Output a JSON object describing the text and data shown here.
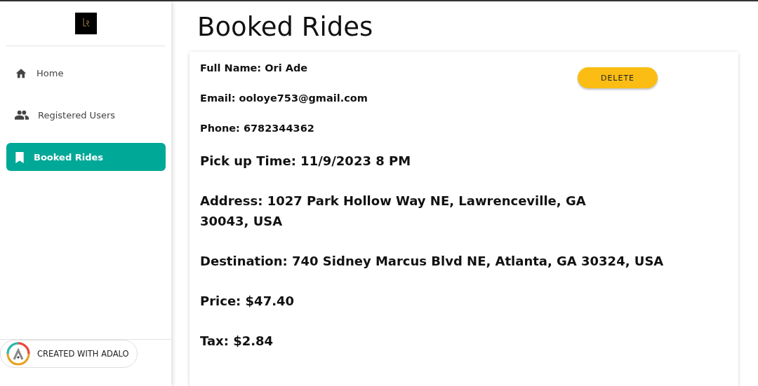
{
  "sidebar": {
    "items": [
      {
        "label": "Home",
        "selected": false
      },
      {
        "label": "Registered Users",
        "selected": false
      },
      {
        "label": "Booked Rides",
        "selected": true
      }
    ]
  },
  "page_title": "Booked Rides",
  "booking": {
    "small_lines": [
      "Full Name: Ori Ade",
      "Email: ooloye753@gmail.com",
      "Phone: 6782344362"
    ],
    "delete_button": "DELETE",
    "large_lines": [
      "Pick up Time: 11/9/2023 8 PM",
      "Address: 1027 Park Hollow Way NE, Lawrenceville, GA 30043, USA",
      "Destination: 740 Sidney Marcus Blvd NE, Atlanta, GA 30324, USA",
      "Price: $47.40",
      "Tax: $2.84"
    ]
  },
  "badge": {
    "label": "CREATED WITH ADALO"
  }
}
